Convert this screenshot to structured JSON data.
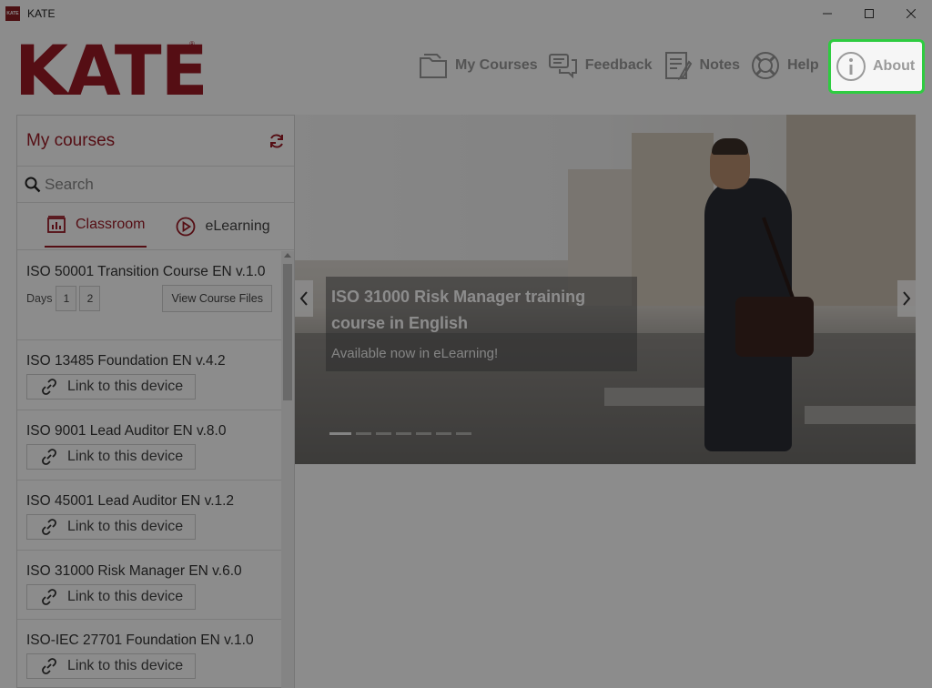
{
  "window": {
    "title": "KATE",
    "icon_text": "KATE",
    "controls": [
      "minimize-icon",
      "maximize-icon",
      "close-icon"
    ]
  },
  "header": {
    "logo": "KATE",
    "logo_mark": "®",
    "nav": [
      {
        "label": "My Courses",
        "icon": "folder-icon"
      },
      {
        "label": "Feedback",
        "icon": "chat-bubbles-icon"
      },
      {
        "label": "Notes",
        "icon": "notes-icon"
      },
      {
        "label": "Help",
        "icon": "lifebuoy-icon"
      },
      {
        "label": "About",
        "icon": "info-icon",
        "highlighted": true
      }
    ]
  },
  "sidebar": {
    "title": "My courses",
    "refresh_icon": "refresh-icon",
    "search_placeholder": "Search",
    "tabs": [
      {
        "label": "Classroom",
        "icon": "classroom-icon",
        "active": true
      },
      {
        "label": "eLearning",
        "icon": "play-circle-icon",
        "active": false
      }
    ],
    "courses": [
      {
        "name": "ISO 50001 Transition Course  EN v.1.0",
        "days_label": "Days",
        "days": [
          "1",
          "2"
        ],
        "action": "View Course Files"
      },
      {
        "name": "ISO 13485 Foundation EN v.4.2",
        "action": "Link to this device"
      },
      {
        "name": "ISO 9001 Lead Auditor EN v.8.0",
        "action": "Link to this device"
      },
      {
        "name": "ISO 45001 Lead Auditor EN v.1.2",
        "action": "Link to this device"
      },
      {
        "name": "ISO 31000 Risk Manager EN v.6.0",
        "action": "Link to this device"
      },
      {
        "name": "ISO-IEC 27701 Foundation EN v.1.0",
        "action": "Link to this device"
      }
    ]
  },
  "banner": {
    "title": "ISO 31000 Risk Manager training course in English",
    "subtitle": "Available now in eLearning!",
    "slide_count": 7,
    "active_slide": 1
  },
  "colors": {
    "brand": "#9b1b26",
    "highlight": "#2ecc40",
    "overlay": "rgba(0,0,0,0.45)"
  }
}
